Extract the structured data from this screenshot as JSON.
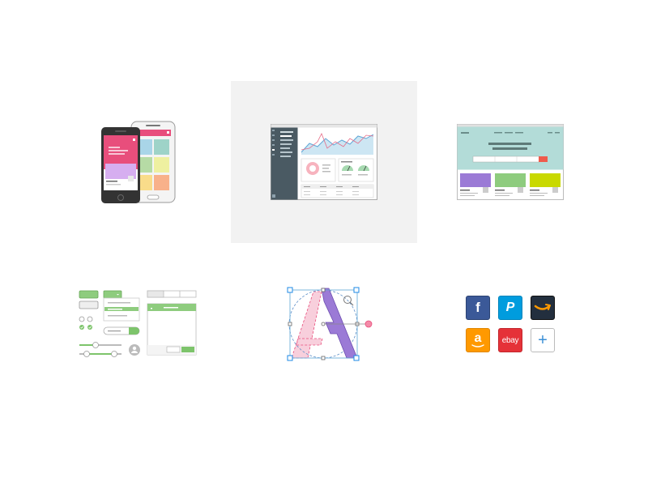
{
  "gallery": {
    "selected_index": 1,
    "tiles": [
      {
        "id": "mobile-mockups",
        "icon": "mobile-phones-icon"
      },
      {
        "id": "dashboard",
        "icon": "dashboard-icon"
      },
      {
        "id": "website",
        "icon": "website-icon"
      },
      {
        "id": "ui-kit",
        "icon": "ui-controls-icon"
      },
      {
        "id": "vector-editing",
        "icon": "vector-letter-a-icon"
      },
      {
        "id": "brand-icons",
        "icon": "brand-logos-icon"
      }
    ]
  },
  "brands": {
    "facebook": {
      "label": "f",
      "color": "#3b5998"
    },
    "paypal": {
      "label": "P",
      "color": "#009cde"
    },
    "amazon_smile": {
      "color": "#232f3e"
    },
    "amazon": {
      "label": "a",
      "color": "#ff9900"
    },
    "ebay": {
      "label": "ebay",
      "color": "#e53238"
    },
    "add": {
      "label": "+",
      "color": "#ffffff"
    }
  },
  "colors": {
    "accent_green": "#7dc46b",
    "accent_pink": "#e84e7c",
    "accent_purple": "#9b7ad6",
    "mint": "#b3dcd8",
    "selection_bg": "#f2f2f2"
  }
}
